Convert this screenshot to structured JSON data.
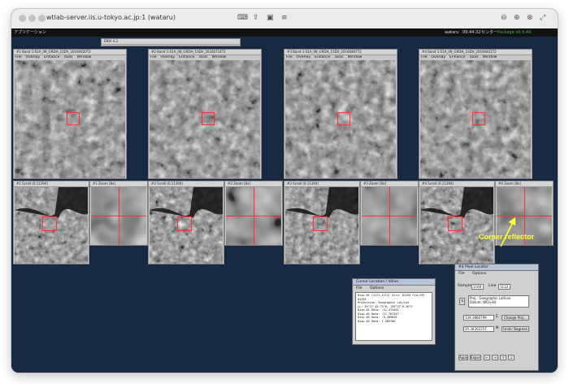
{
  "window_title": "wtlab-server.iis.u-tokyo.ac.jp:1 (wataru)",
  "toolbar_icons": [
    "keyboard-icon",
    "share-icon",
    "stack-icon",
    "menu-icon",
    "zoom-out-icon",
    "zoom-in-icon",
    "zoom-fit-icon",
    "fullscreen-icon"
  ],
  "gnome_panel": {
    "apps_label": "アプリケーション",
    "user": "wataru",
    "time": "09:44:32",
    "center": "センター",
    "package_text": "Package v0.9.49"
  },
  "envi_window": {
    "title": "ENVI 4.2"
  },
  "band_windows": [
    {
      "title": "#1 Band 1:S1A_IW_GRDH_1SDV_20160620T2",
      "menu": [
        "File",
        "Overlay",
        "Enhance",
        "Tools",
        "Window"
      ]
    },
    {
      "title": "#2 Band 1:S1A_IW_GRDH_1SDV_20160714T2",
      "menu": [
        "File",
        "Overlay",
        "Enhance",
        "Tools",
        "Window"
      ]
    },
    {
      "title": "#3 Band 1:S1A_IW_GRDH_1SDV_20160807T2",
      "menu": [
        "File",
        "Overlay",
        "Enhance",
        "Tools",
        "Window"
      ]
    },
    {
      "title": "#4 Band 1:S1A_IW_GRDH_1SDV_20160831T2",
      "menu": [
        "File",
        "Overlay",
        "Enhance",
        "Tools",
        "Window"
      ]
    }
  ],
  "scroll_titles": [
    "#1 Scroll (0.11394)",
    "#2 Scroll (0.11394)",
    "#3 Scroll (0.11394)",
    "#4 Scroll (0.11394)"
  ],
  "zoom_titles": [
    "#1 Zoom [8x]",
    "#2 Zoom [8x]",
    "#3 Zoom [8x]",
    "#4 Zoom [8x]"
  ],
  "cursor_dialog": {
    "title": "Cursor Location / Value",
    "menu": [
      "File",
      "Options"
    ],
    "lines": [
      "Disp #1 (1171,1112) Scrn: 81255 Grd:255 81255",
      "Projection: Geographic Lat/Lon",
      "LL: 35°37'45.73\"N, 139°37'8.36\"E",
      "Disp #1 Data: -11.474451",
      "Disp #2 Data: -11.767447",
      "Disp #3 Data: -9.469026",
      "Disp #4 Data: 7.569786"
    ]
  },
  "pixel_dialog": {
    "title": "#4 Pixel Locator",
    "menu": [
      "File",
      "Options"
    ],
    "sample_label": "Sample",
    "sample_value": "1169",
    "line_label": "Line",
    "line_value": "1112",
    "proj_lines": [
      "Proj : Geographic Lat/Lon",
      "Datum: WGS-84"
    ],
    "lon_value": "139.3860799",
    "lon_dir": "E",
    "lat_value": "35.36202257",
    "lat_dir": "N",
    "change_proj": "Change Proj...",
    "units": "Units: Degrees",
    "buttons": [
      "Apply",
      "Export"
    ]
  },
  "annotation": "Corner reflector",
  "colors": {
    "desktop": "#182a42",
    "annotation": "#ffff33",
    "crosshair": "#ff3030"
  }
}
